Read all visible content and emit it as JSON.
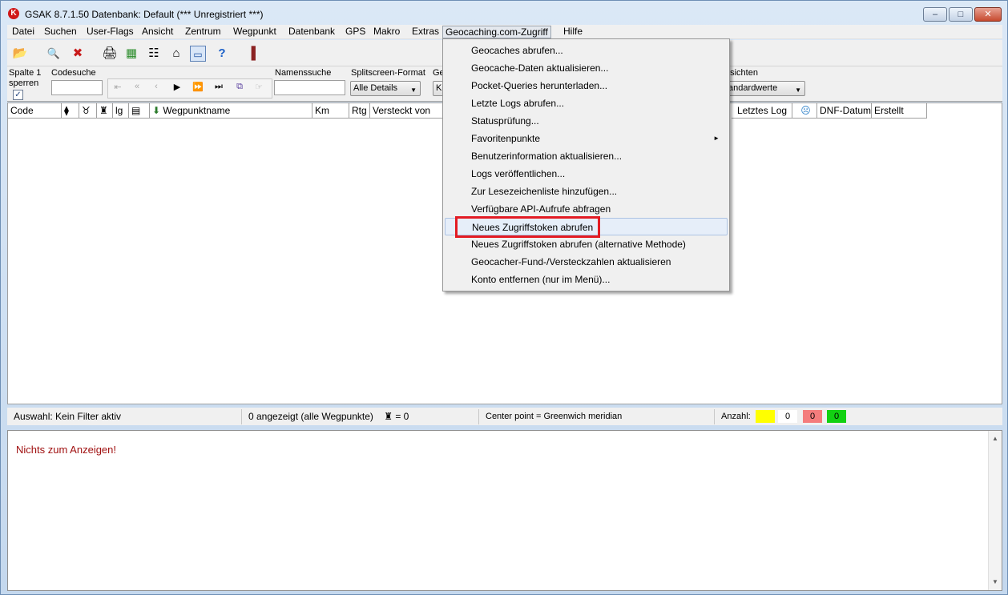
{
  "window": {
    "title": "GSAK 8.7.1.50   Datenbank: Default   (*** Unregistriert ***)",
    "minimize": "–",
    "maximize": "□",
    "close": "✕"
  },
  "menu": [
    {
      "label": "Datei"
    },
    {
      "label": "Suchen"
    },
    {
      "label": "User-Flags"
    },
    {
      "label": "Ansicht"
    },
    {
      "label": "Zentrum"
    },
    {
      "label": "Wegpunkt"
    },
    {
      "label": "Datenbank"
    },
    {
      "label": "GPS"
    },
    {
      "label": "Makro"
    },
    {
      "label": "Extras"
    },
    {
      "label": "Geocaching.com-Zugriff"
    },
    {
      "label": "Hilfe"
    }
  ],
  "toolbar": {
    "icons": [
      "folder-open-icon",
      "print-preview-icon",
      "delete-icon",
      "printer-icon",
      "grid-view-icon",
      "export-icon",
      "home-icon",
      "window-icon",
      "help-icon",
      "exit-icon"
    ]
  },
  "filterbar": {
    "lock_label_1": "Spalte 1",
    "lock_label_2": "sperren",
    "lock_checked": "✓",
    "code_label": "Codesuche",
    "name_label": "Namenssuche",
    "split_label": "Splitscreen-Format",
    "split_value": "Alle Details",
    "ge_label": "Ge",
    "ke_value": "K",
    "views_label": "nsichten",
    "views_value": "tandardwerte"
  },
  "columns": [
    {
      "label": "Code"
    },
    {
      "label": ""
    },
    {
      "label": ""
    },
    {
      "label": ""
    },
    {
      "label": "lg"
    },
    {
      "label": ""
    },
    {
      "label": "Wegpunktname"
    },
    {
      "label": "Km"
    },
    {
      "label": "Rtg"
    },
    {
      "label": "Versteckt von"
    },
    {
      "label": "Letztes Log"
    },
    {
      "label": ""
    },
    {
      "label": "DNF-Datum"
    },
    {
      "label": "Erstellt"
    }
  ],
  "status": {
    "filter": "Auswahl: Kein Filter aktiv",
    "shown": "0 angezeigt (alle Wegpunkte)",
    "found": "= 0",
    "center": "Center point = Greenwich meridian",
    "count_label": "Anzahl:",
    "count_yellow": "",
    "count_white": "0",
    "count_red": "0",
    "count_green": "0",
    "color_yellow": "#ffff00",
    "color_red": "#f47c7c",
    "color_green": "#12d112"
  },
  "info": {
    "message": "Nichts zum Anzeigen!"
  },
  "dropdown": [
    {
      "label": "Geocaches abrufen..."
    },
    {
      "label": "Geocache-Daten aktualisieren..."
    },
    {
      "label": "Pocket-Queries herunterladen..."
    },
    {
      "label": "Letzte Logs abrufen..."
    },
    {
      "label": "Statusprüfung..."
    },
    {
      "label": "Favoritenpunkte",
      "submenu": "►"
    },
    {
      "label": "Benutzerinformation aktualisieren..."
    },
    {
      "label": "Logs veröffentlichen..."
    },
    {
      "label": "Zur Lesezeichenliste hinzufügen..."
    },
    {
      "label": "Verfügbare API-Aufrufe abfragen"
    },
    {
      "label": "Neues Zugriffstoken abrufen"
    },
    {
      "label": "Neues Zugriffstoken abrufen (alternative Methode)"
    },
    {
      "label": "Geocacher-Fund-/Versteckzahlen aktualisieren"
    },
    {
      "label": "Konto entfernen (nur im Menü)..."
    }
  ],
  "accent": {
    "highlight": "#e31b23"
  }
}
